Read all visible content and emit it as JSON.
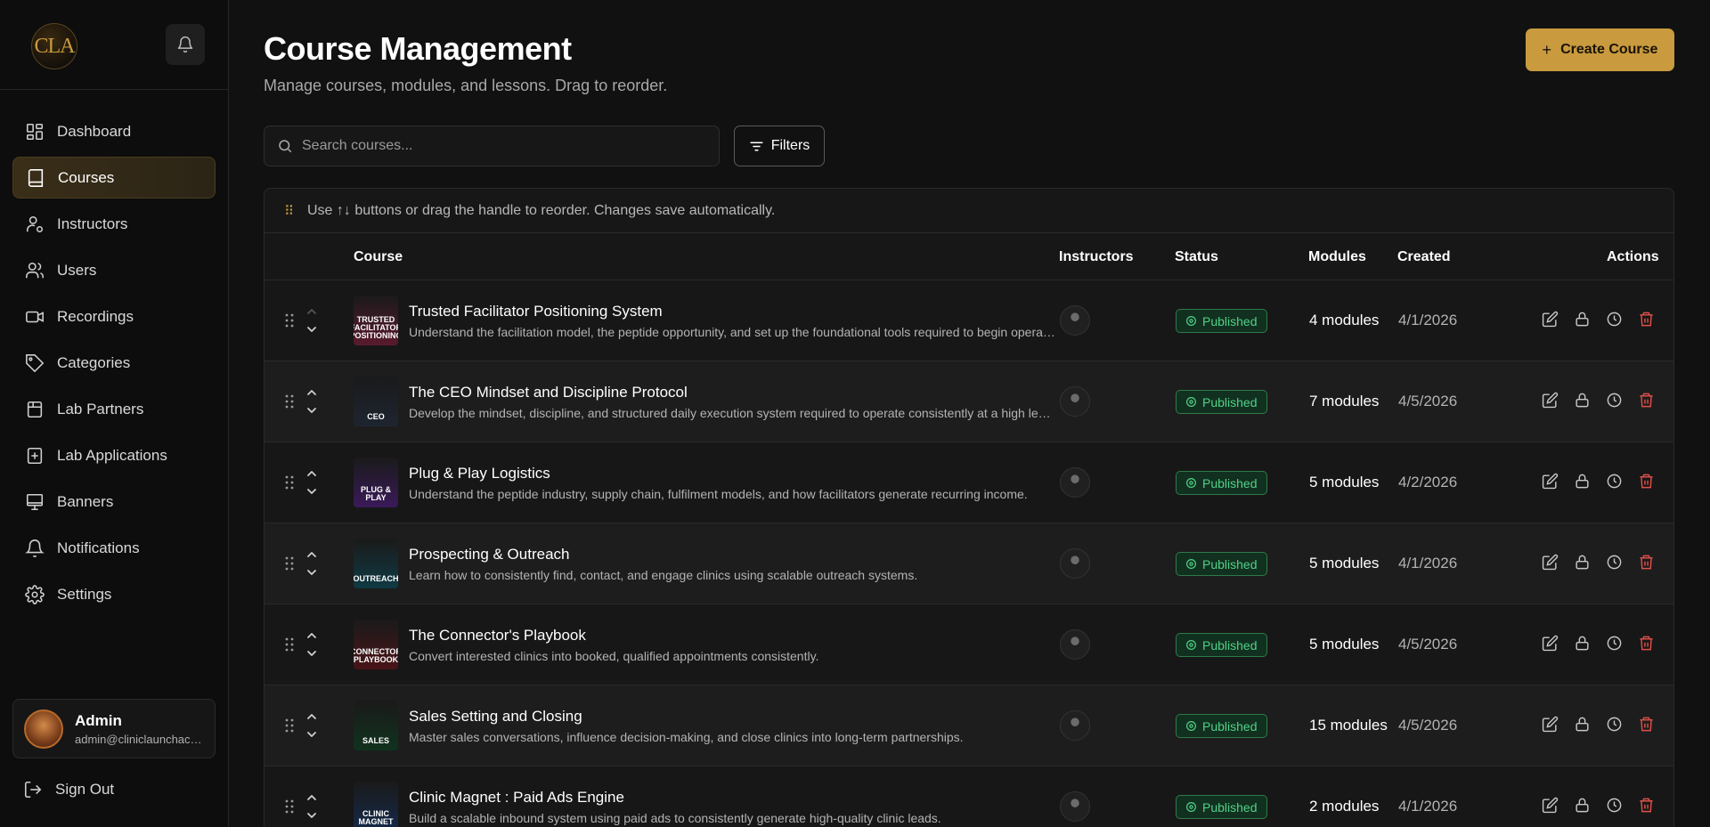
{
  "sidebar": {
    "logo_text": "CLA",
    "nav": [
      {
        "label": "Dashboard",
        "icon": "dashboard-icon",
        "active": false
      },
      {
        "label": "Courses",
        "icon": "book-icon",
        "active": true
      },
      {
        "label": "Instructors",
        "icon": "instructor-icon",
        "active": false
      },
      {
        "label": "Users",
        "icon": "users-icon",
        "active": false
      },
      {
        "label": "Recordings",
        "icon": "video-icon",
        "active": false
      },
      {
        "label": "Categories",
        "icon": "tag-icon",
        "active": false
      },
      {
        "label": "Lab Partners",
        "icon": "lab-partners-icon",
        "active": false
      },
      {
        "label": "Lab Applications",
        "icon": "lab-applications-icon",
        "active": false
      },
      {
        "label": "Banners",
        "icon": "monitor-icon",
        "active": false
      },
      {
        "label": "Notifications",
        "icon": "bell-icon",
        "active": false
      },
      {
        "label": "Settings",
        "icon": "gear-icon",
        "active": false
      }
    ],
    "user": {
      "name": "Admin",
      "email": "admin@cliniclaunchacademy.com"
    },
    "signout_label": "Sign Out"
  },
  "header": {
    "title": "Course Management",
    "subtitle": "Manage courses, modules, and lessons. Drag to reorder.",
    "create_label": "Create Course"
  },
  "search": {
    "placeholder": "Search courses..."
  },
  "filters_label": "Filters",
  "hint": "Use ↑↓ buttons or drag the handle to reorder. Changes save automatically.",
  "columns": {
    "course": "Course",
    "instructors": "Instructors",
    "status": "Status",
    "modules": "Modules",
    "created": "Created",
    "actions": "Actions"
  },
  "courses": [
    {
      "title": "Trusted Facilitator Positioning System",
      "description": "Understand the facilitation model, the peptide opportunity, and set up the foundational tools required to begin operating as a trusted facilitator.",
      "status": "Published",
      "modules": "4 modules",
      "created": "4/1/2026",
      "thumb_color": "#5a1a2e",
      "thumb_label": "TRUSTED FACILITATOR POSITIONING"
    },
    {
      "title": "The CEO Mindset and Discipline Protocol",
      "description": "Develop the mindset, discipline, and structured daily execution system required to operate consistently at a high level.",
      "status": "Published",
      "modules": "7 modules",
      "created": "4/5/2026",
      "thumb_color": "#1e2530",
      "thumb_label": "CEO"
    },
    {
      "title": "Plug & Play Logistics",
      "description": "Understand the peptide industry, supply chain, fulfilment models, and how facilitators generate recurring income.",
      "status": "Published",
      "modules": "5 modules",
      "created": "4/2/2026",
      "thumb_color": "#3a1a5a",
      "thumb_label": "PLUG & PLAY"
    },
    {
      "title": "Prospecting & Outreach",
      "description": "Learn how to consistently find, contact, and engage clinics using scalable outreach systems.",
      "status": "Published",
      "modules": "5 modules",
      "created": "4/1/2026",
      "thumb_color": "#0f3a44",
      "thumb_label": "OUTREACH"
    },
    {
      "title": "The Connector's Playbook",
      "description": "Convert interested clinics into booked, qualified appointments consistently.",
      "status": "Published",
      "modules": "5 modules",
      "created": "4/5/2026",
      "thumb_color": "#4a1418",
      "thumb_label": "CONNECTOR PLAYBOOK"
    },
    {
      "title": "Sales Setting and Closing",
      "description": "Master sales conversations, influence decision-making, and close clinics into long-term partnerships.",
      "status": "Published",
      "modules": "15 modules",
      "created": "4/5/2026",
      "thumb_color": "#10321e",
      "thumb_label": "SALES"
    },
    {
      "title": "Clinic Magnet : Paid Ads Engine",
      "description": "Build a scalable inbound system using paid ads to consistently generate high-quality clinic leads.",
      "status": "Published",
      "modules": "2 modules",
      "created": "4/1/2026",
      "thumb_color": "#142a4a",
      "thumb_label": "CLINIC MAGNET"
    }
  ],
  "colors": {
    "accent": "#c99a3e",
    "published": "#4fd188",
    "danger": "#e0504a"
  }
}
